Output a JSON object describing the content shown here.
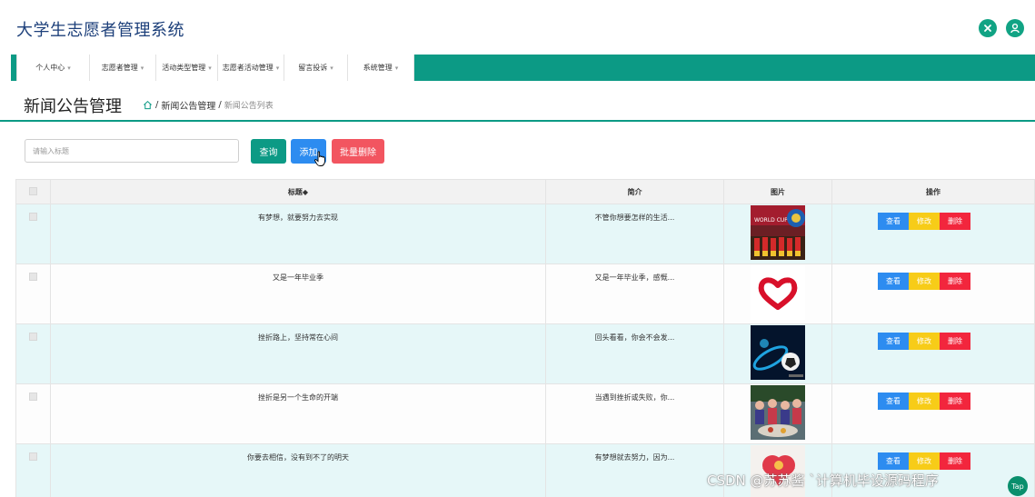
{
  "app": {
    "title": "大学生志愿者管理系统"
  },
  "header_icons": [
    "fullscreen-exit-icon",
    "user-icon"
  ],
  "nav": {
    "items": [
      {
        "label": "个人中心",
        "width": 80
      },
      {
        "label": "志愿者管理",
        "width": 73
      },
      {
        "label": "活动类型管理",
        "width": 68
      },
      {
        "label": "志愿者活动管理",
        "width": 73
      },
      {
        "label": "留言投诉",
        "width": 70
      },
      {
        "label": "系统管理",
        "width": 73
      }
    ]
  },
  "page": {
    "title": "新闻公告管理",
    "breadcrumb": {
      "section": "新闻公告管理",
      "current": "新闻公告列表"
    }
  },
  "toolbar": {
    "search_placeholder": "请输入标题",
    "query_label": "查询",
    "add_label": "添加",
    "batch_delete_label": "批量删除"
  },
  "table": {
    "headers": {
      "title": "标题◆",
      "intro": "简介",
      "image": "图片",
      "actions": "操作"
    },
    "rows": [
      {
        "title": "有梦想，就要努力去实现",
        "intro": "不管你想要怎样的生活...",
        "image": "worldcup"
      },
      {
        "title": "又是一年毕业季",
        "intro": "又是一年毕业季，感慨...",
        "image": "heart"
      },
      {
        "title": "挫折路上，坚持常在心间",
        "intro": "回头看看，你会不会发...",
        "image": "soccer"
      },
      {
        "title": "挫折是另一个生命的开端",
        "intro": "当遇到挫折或失败，你...",
        "image": "party"
      },
      {
        "title": "你要去相信，没有到不了的明天",
        "intro": "有梦想就去努力，因为...",
        "image": "red"
      }
    ],
    "action_labels": {
      "view": "查看",
      "edit": "修改",
      "delete": "删除"
    }
  },
  "watermark": {
    "text": "CSDN @苏苏酱  `计算机毕设源码程序",
    "badge": "Tap"
  },
  "colors": {
    "accent": "#0c9a85",
    "blue": "#2d8cf0",
    "yellow": "#f7cc18",
    "red": "#f2263d",
    "title": "#1c3f7a"
  }
}
